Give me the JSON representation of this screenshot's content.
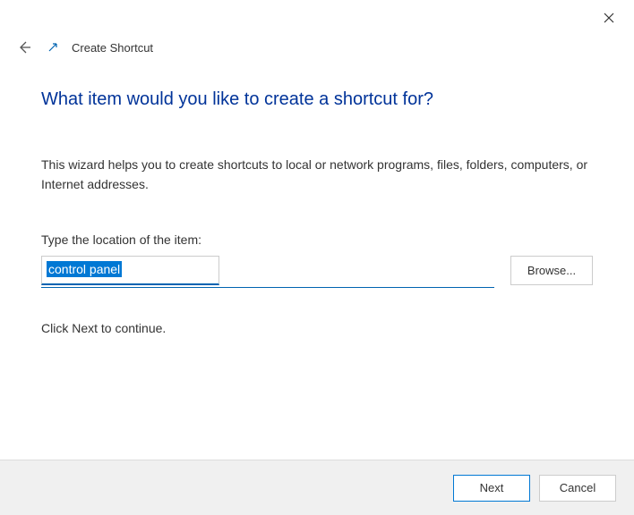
{
  "window": {
    "title": "Create Shortcut"
  },
  "wizard": {
    "heading": "What item would you like to create a shortcut for?",
    "description": "This wizard helps you to create shortcuts to local or network programs, files, folders, computers, or Internet addresses.",
    "input_label": "Type the location of the item:",
    "input_value": "control panel",
    "browse_label": "Browse...",
    "continue_text": "Click Next to continue."
  },
  "footer": {
    "next_label": "Next",
    "cancel_label": "Cancel"
  }
}
